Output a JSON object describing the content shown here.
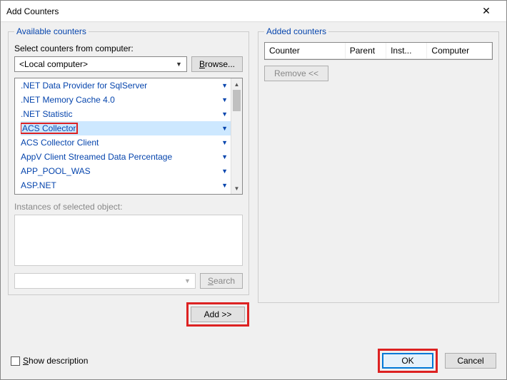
{
  "title": "Add Counters",
  "left": {
    "legend": "Available counters",
    "selectLabel": "Select counters from computer:",
    "computerValue": "<Local computer>",
    "browseLabel": "Browse...",
    "instancesLabel": "Instances of selected object:",
    "searchLabel": "Search",
    "addLabel": "Add >>",
    "items": [
      {
        "label": ".NET Data Provider for SqlServer"
      },
      {
        "label": ".NET Memory Cache 4.0"
      },
      {
        "label": ".NET Statistic"
      },
      {
        "label": "ACS Collector"
      },
      {
        "label": "ACS Collector Client"
      },
      {
        "label": "AppV Client Streamed Data Percentage"
      },
      {
        "label": "APP_POOL_WAS"
      },
      {
        "label": "ASP.NET"
      }
    ],
    "selectedIndex": 3
  },
  "right": {
    "legend": "Added counters",
    "cols": {
      "counter": "Counter",
      "parent": "Parent",
      "inst": "Inst...",
      "computer": "Computer"
    },
    "removeLabel": "Remove <<"
  },
  "footer": {
    "showDesc": "Show description",
    "ok": "OK",
    "cancel": "Cancel"
  }
}
